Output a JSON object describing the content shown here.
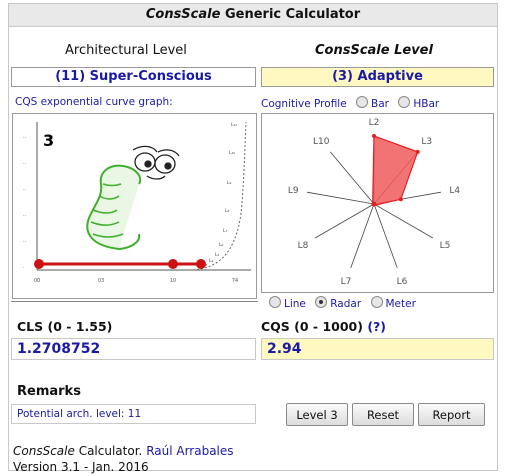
{
  "title": {
    "brand": "ConsScale",
    "rest": "Generic Calculator"
  },
  "architectural": {
    "heading": "Architectural Level",
    "value": "(11) Super-Conscious"
  },
  "consscale": {
    "heading": "ConsScale Level",
    "value": "(3) Adaptive"
  },
  "graph": {
    "label": "CQS exponential curve graph:",
    "big_number": "3",
    "x_ticks": [
      "00",
      "03",
      "10",
      "74"
    ],
    "y_ticks": [
      "..",
      "..",
      "..",
      "..",
      "..",
      "."
    ],
    "level_marks": [
      "L₁₁",
      "L₁₀",
      "L₉",
      "L₈",
      "L₇",
      "L₆",
      "L₅",
      "L₄",
      "L₃"
    ]
  },
  "profile": {
    "label": "Cognitive Profile",
    "options": [
      "Bar",
      "HBar"
    ],
    "selected": ""
  },
  "radar": {
    "labels": [
      "L2",
      "L3",
      "L4",
      "L5",
      "L6",
      "L7",
      "L8",
      "L9",
      "L10"
    ],
    "values": [
      1.0,
      1.0,
      0.4,
      0.0,
      0.0,
      0.0,
      0.0,
      0.0,
      0.0
    ],
    "fill_color": "#f05a5a",
    "stroke_color": "#e02020"
  },
  "graph_type": {
    "options": [
      "Line",
      "Radar",
      "Meter"
    ],
    "selected": "Radar"
  },
  "cls": {
    "label": "CLS (0 - 1.55)",
    "value": "1.2708752"
  },
  "cqs": {
    "label": "CQS (0 - 1000)",
    "help": "(?)",
    "value": "2.94"
  },
  "remarks": {
    "label": "Remarks",
    "text": "Potential arch. level: 11"
  },
  "buttons": {
    "level": "Level 3",
    "reset": "Reset",
    "report": "Report"
  },
  "footer": {
    "brand": "ConsScale",
    "text": "Calculator.",
    "author": "Raúl Arrabales",
    "version": "Version 3.1 - Jan. 2016"
  },
  "colors": {
    "accent_blue": "#1a1aa6",
    "highlight_yellow": "#fff8c0",
    "curve_red": "#cc1111",
    "worm_green": "#3fae2a"
  }
}
